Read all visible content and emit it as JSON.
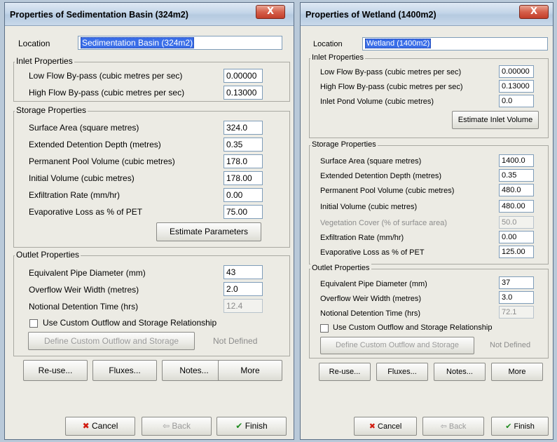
{
  "sed": {
    "title": "Properties of Sedimentation Basin (324m2)",
    "close_label": "X",
    "location_label": "Location",
    "location_value": "Sedimentation Basin (324m2)",
    "inlet": {
      "legend": "Inlet Properties",
      "low_label": "Low Flow By-pass (cubic metres per sec)",
      "low_value": "0.00000",
      "high_label": "High Flow By-pass (cubic metres per sec)",
      "high_value": "0.13000"
    },
    "storage": {
      "legend": "Storage Properties",
      "surface_label": "Surface Area (square metres)",
      "surface_value": "324.0",
      "edd_label": "Extended Detention Depth (metres)",
      "edd_value": "0.35",
      "ppv_label": "Permanent Pool Volume (cubic metres)",
      "ppv_value": "178.0",
      "iv_label": "Initial Volume (cubic metres)",
      "iv_value": "178.00",
      "exf_label": "Exfiltration Rate (mm/hr)",
      "exf_value": "0.00",
      "evap_label": "Evaporative Loss as % of PET",
      "evap_value": "75.00",
      "estimate_button": "Estimate Parameters"
    },
    "outlet": {
      "legend": "Outlet Properties",
      "pipe_label": "Equivalent Pipe Diameter (mm)",
      "pipe_value": "43",
      "weir_label": "Overflow Weir Width (metres)",
      "weir_value": "2.0",
      "ndt_label": "Notional Detention Time (hrs)",
      "ndt_value": "12.4",
      "custom_checkbox_label": "Use Custom Outflow and Storage Relationship",
      "define_button": "Define Custom Outflow and Storage",
      "not_defined": "Not Defined"
    },
    "buttons": {
      "reuse": "Re-use...",
      "fluxes": "Fluxes...",
      "notes": "Notes...",
      "more": "More"
    },
    "nav": {
      "cancel": "Cancel",
      "back": "Back",
      "finish": "Finish"
    }
  },
  "wet": {
    "title": "Properties of Wetland (1400m2)",
    "close_label": "X",
    "location_label": "Location",
    "location_value": "Wetland (1400m2)",
    "inlet": {
      "legend": "Inlet Properties",
      "low_label": "Low Flow By-pass (cubic metres per sec)",
      "low_value": "0.00000",
      "high_label": "High Flow By-pass (cubic metres per sec)",
      "high_value": "0.13000",
      "pond_label": "Inlet Pond Volume (cubic metres)",
      "pond_value": "0.0",
      "estimate_button": "Estimate Inlet Volume"
    },
    "storage": {
      "legend": "Storage Properties",
      "surface_label": "Surface Area (square metres)",
      "surface_value": "1400.0",
      "edd_label": "Extended Detention Depth (metres)",
      "edd_value": "0.35",
      "ppv_label": "Permanent Pool Volume (cubic metres)",
      "ppv_value": "480.0",
      "iv_label": "Initial Volume (cubic metres)",
      "iv_value": "480.00",
      "veg_label": "Vegetation Cover (% of surface area)",
      "veg_value": "50.0",
      "exf_label": "Exfiltration Rate (mm/hr)",
      "exf_value": "0.00",
      "evap_label": "Evaporative Loss as % of PET",
      "evap_value": "125.00"
    },
    "outlet": {
      "legend": "Outlet Properties",
      "pipe_label": "Equivalent Pipe Diameter (mm)",
      "pipe_value": "37",
      "weir_label": "Overflow Weir Width (metres)",
      "weir_value": "3.0",
      "ndt_label": "Notional Detention Time (hrs)",
      "ndt_value": "72.1",
      "custom_checkbox_label": "Use Custom Outflow and Storage Relationship",
      "define_button": "Define Custom Outflow and Storage",
      "not_defined": "Not Defined"
    },
    "buttons": {
      "reuse": "Re-use...",
      "fluxes": "Fluxes...",
      "notes": "Notes...",
      "more": "More"
    },
    "nav": {
      "cancel": "Cancel",
      "back": "Back",
      "finish": "Finish"
    }
  }
}
